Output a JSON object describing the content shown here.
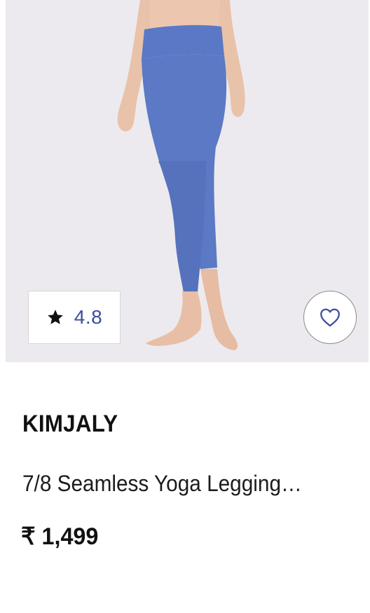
{
  "product": {
    "rating": "4.8",
    "brand": "KIMJALY",
    "title": "7/8 Seamless Yoga Legging…",
    "price": "₹ 1,499",
    "image": {
      "background_color": "#eceaee",
      "legging_color": "#5b79c4"
    }
  },
  "icons": {
    "rating": "star-icon",
    "wishlist": "heart-icon"
  },
  "colors": {
    "rating_text": "#3b4e9e",
    "wishlist_icon": "#3b4e9e",
    "text_primary": "#111111"
  }
}
